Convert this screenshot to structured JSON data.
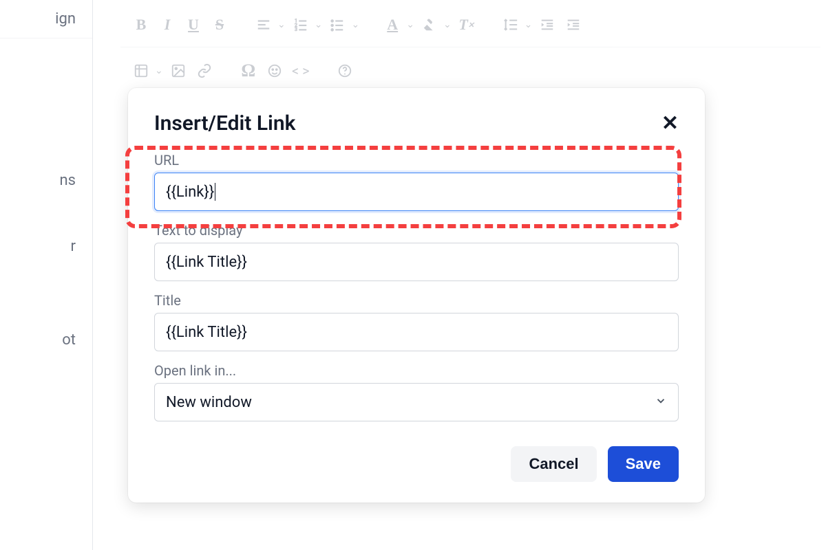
{
  "sidebar": {
    "items": [
      "ign",
      "",
      "",
      "ns",
      "r",
      "",
      "ot"
    ]
  },
  "toolbar": {
    "row1": [
      "B",
      "I",
      "U",
      "S"
    ],
    "row2_groups": [
      "align",
      "ol",
      "ul"
    ],
    "row3_groups": [
      "textcolor",
      "highlight",
      "clear"
    ],
    "row4_groups": [
      "lineheight",
      "outdent",
      "indent"
    ]
  },
  "dialog": {
    "title": "Insert/Edit Link",
    "fields": {
      "url": {
        "label": "URL",
        "value": "{{Link}}"
      },
      "text": {
        "label": "Text to display",
        "value": "{{Link Title}}"
      },
      "title_f": {
        "label": "Title",
        "value": "{{Link Title}}"
      },
      "open": {
        "label": "Open link in...",
        "value": "New window"
      }
    },
    "buttons": {
      "cancel": "Cancel",
      "save": "Save"
    }
  }
}
